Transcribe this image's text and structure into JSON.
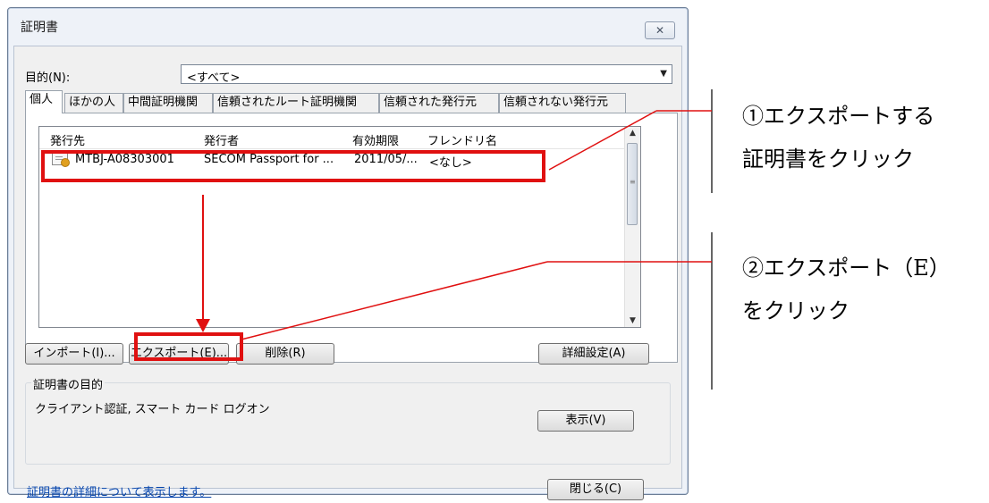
{
  "dialog": {
    "title": "証明書",
    "close_label": "✕",
    "purpose_label": "目的(N):",
    "purpose_value": "<すべて>",
    "tabs": [
      "個人",
      "ほかの人",
      "中間証明機関",
      "信頼されたルート証明機関",
      "信頼された発行元",
      "信頼されない発行元"
    ],
    "list": {
      "columns": [
        "発行先",
        "発行者",
        "有効期限",
        "フレンドリ名"
      ],
      "rows": [
        {
          "issued_to": "MTBJ-A08303001",
          "issuer": "SECOM Passport for ...",
          "expires": "2011/05/...",
          "friendly_name": "<なし>"
        }
      ]
    },
    "buttons": {
      "import": "インポート(I)...",
      "export": "エクスポート(E)...",
      "delete": "削除(R)",
      "advanced": "詳細設定(A)",
      "view": "表示(V)",
      "close": "閉じる(C)"
    },
    "purpose_group": {
      "title": "証明書の目的",
      "text": "クライアント認証, スマート カード ログオン"
    },
    "details_link": "証明書の詳細について表示します。"
  },
  "annotations": {
    "step1_line1": "①エクスポートする",
    "step1_line2": "証明書をクリック",
    "step2_line1": "②エクスポート（E）",
    "step2_line2": "をクリック",
    "highlight_color": "#e01010"
  }
}
